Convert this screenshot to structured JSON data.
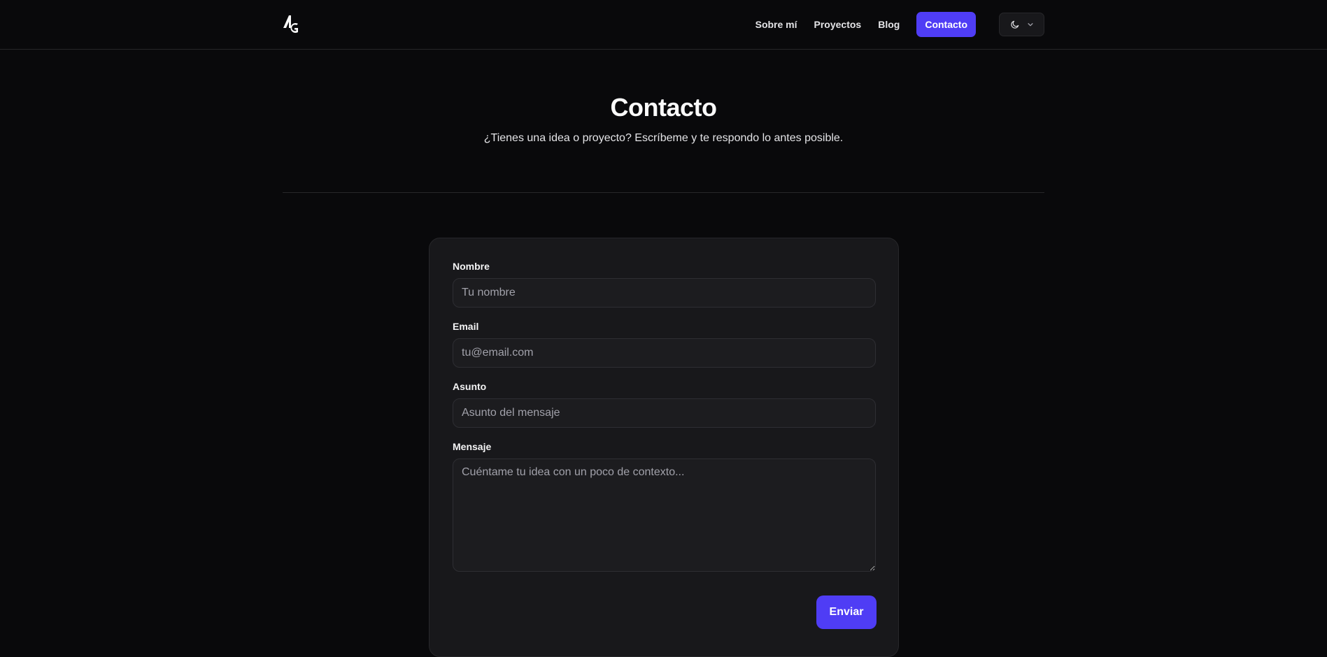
{
  "brand": {
    "logo_text": "AG",
    "logo_icon": "ag-monogram-logo"
  },
  "nav": {
    "items": [
      {
        "label": "Sobre mí"
      },
      {
        "label": "Proyectos"
      },
      {
        "label": "Blog"
      },
      {
        "label": "Contacto",
        "active": true
      }
    ],
    "theme_toggle": {
      "icon": "moon-icon",
      "dropdown_icon": "chevron-down-icon"
    }
  },
  "hero": {
    "title": "Contacto",
    "subtitle": "¿Tienes una idea o proyecto? Escríbeme y te respondo lo antes posible."
  },
  "form": {
    "name": {
      "label": "Nombre",
      "placeholder": "Tu nombre",
      "value": ""
    },
    "email": {
      "label": "Email",
      "placeholder": "tu@email.com",
      "value": ""
    },
    "subject": {
      "label": "Asunto",
      "placeholder": "Asunto del mensaje",
      "value": ""
    },
    "message": {
      "label": "Mensaje",
      "placeholder": "Cuéntame tu idea con un poco de contexto...",
      "value": ""
    },
    "submit_label": "Enviar"
  },
  "colors": {
    "background": "#09090b",
    "accent": "#4f3df5",
    "card": "#18181b",
    "border": "#27272a"
  }
}
